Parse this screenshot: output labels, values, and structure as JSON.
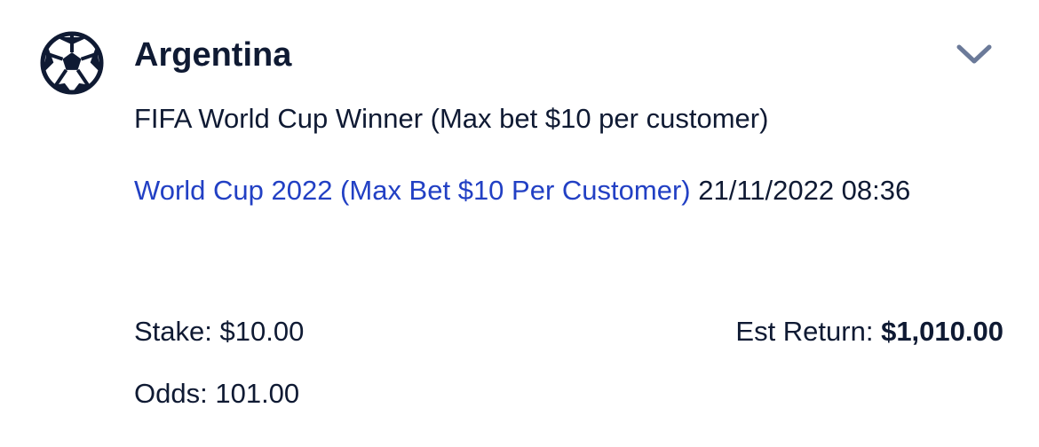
{
  "bet": {
    "sport_icon": "soccer-ball-icon",
    "selection": "Argentina",
    "expand_icon": "chevron-down-icon",
    "market": "FIFA World Cup Winner (Max bet $10 per customer)",
    "event": {
      "name": "World Cup 2022 (Max Bet $10 Per Customer)",
      "datetime": "21/11/2022 08:36"
    },
    "stake": {
      "label": "Stake:",
      "value": "$10.00"
    },
    "est_return": {
      "label": "Est Return:",
      "value": "$1,010.00"
    },
    "odds": {
      "label": "Odds:",
      "value": "101.00"
    }
  },
  "colors": {
    "text": "#0f1a33",
    "link": "#2240c4",
    "chevron": "#6b7a99",
    "background": "#ffffff"
  }
}
